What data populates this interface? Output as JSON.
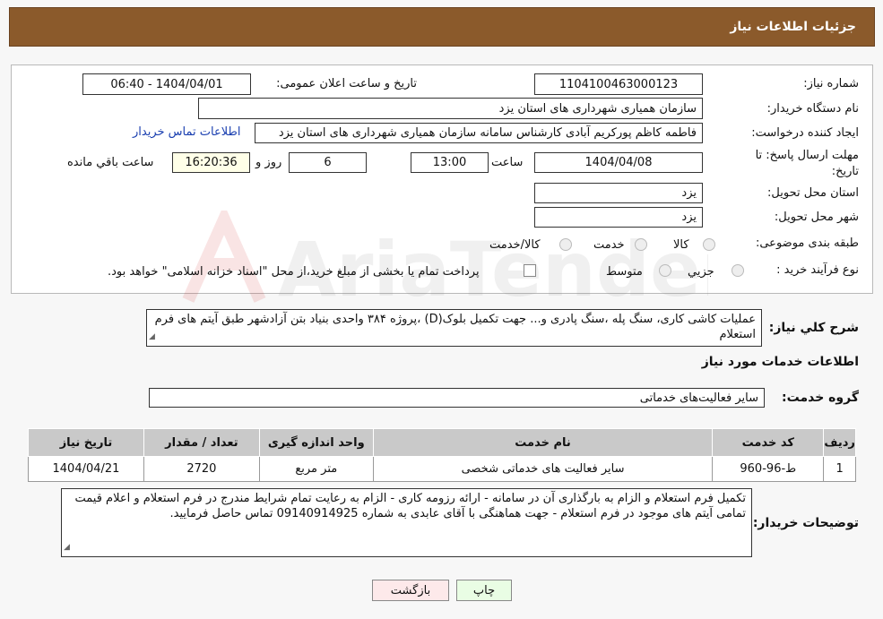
{
  "header": {
    "title": "جزئیات اطلاعات نیاز"
  },
  "form": {
    "need_number": {
      "label": "شماره نیاز:",
      "value": "1104100463000123"
    },
    "announce": {
      "label": "تاریخ و ساعت اعلان عمومی:",
      "value": "1404/04/01 - 06:40"
    },
    "buyer_org": {
      "label": "نام دستگاه خریدار:",
      "value": "سازمان همیاری شهرداری های استان یزد"
    },
    "creator": {
      "label": "ایجاد کننده درخواست:",
      "value": "فاطمه کاظم پورکریم آبادی کارشناس سامانه سازمان همیاری شهرداری های استان یزد",
      "contact_link": "اطلاعات تماس خریدار"
    },
    "deadline": {
      "label": "مهلت ارسال پاسخ: تا تاریخ:",
      "date": "1404/04/08",
      "time_label": "ساعت",
      "time": "13:00",
      "days": "6",
      "days_label": "روز و",
      "remaining": "16:20:36",
      "remaining_label": "ساعت باقي مانده"
    },
    "province": {
      "label": "استان محل تحویل:",
      "value": "یزد"
    },
    "city": {
      "label": "شهر محل تحویل:",
      "value": "یزد"
    },
    "category": {
      "label": "طبقه بندی موضوعی:",
      "options": [
        "کالا",
        "خدمت",
        "کالا/خدمت"
      ]
    },
    "process": {
      "label": "نوع فرآیند خرید :",
      "options": [
        "جزيي",
        "متوسط"
      ],
      "note": "پرداخت تمام یا بخشی از مبلغ خرید،از محل \"اسناد خزانه اسلامی\" خواهد بود."
    }
  },
  "description": {
    "label": "شرح كلي نياز:",
    "text": "عملیات کاشی کاری، سنگ پله ،سنگ پادری و... جهت تکمیل بلوک(D) ،پروژه ۳۸۴ واحدی بنیاد بتن آزادشهر طبق آیتم های فرم استعلام"
  },
  "services": {
    "section_title": "اطلاعات خدمات مورد نیاز",
    "group_label": "گروه خدمت:",
    "group_value": "سایر فعالیت‌های خدماتی",
    "columns": [
      "ردیف",
      "کد خدمت",
      "نام خدمت",
      "واحد اندازه گیری",
      "تعداد / مقدار",
      "تاریخ نیاز"
    ],
    "rows": [
      [
        "1",
        "ط-96-960",
        "سایر فعالیت های خدماتی شخصی",
        "متر مربع",
        "2720",
        "1404/04/21"
      ]
    ]
  },
  "buyer_notes": {
    "label": "توضیحات خریدار:",
    "text": "تکمیل فرم استعلام و الزام به بارگذاری آن در سامانه - ارائه رزومه کاری - الزام به رعایت تمام شرایط مندرج در فرم استعلام و اعلام قیمت تمامی آیتم های موجود در فرم استعلام - جهت هماهنگی با آقای عابدی به شماره 09140914925 تماس حاصل فرمایید."
  },
  "buttons": {
    "print": "چاپ",
    "back": "بازگشت"
  },
  "watermark": {
    "text": "AriaTender.net"
  }
}
